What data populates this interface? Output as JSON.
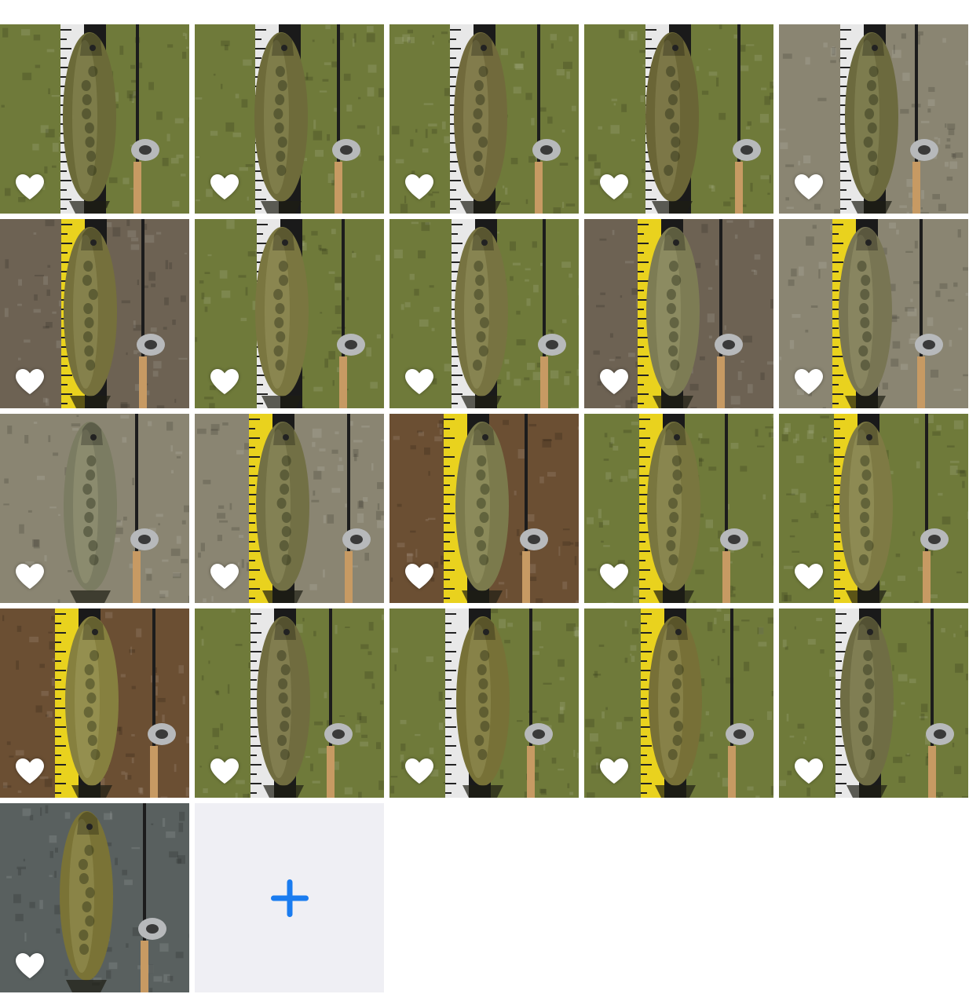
{
  "photos": [
    {
      "id": 1,
      "bg": "grass",
      "ruler": "white",
      "fish": "#6b6a38",
      "liked": false
    },
    {
      "id": 2,
      "bg": "grass",
      "ruler": "white",
      "fish": "#6e6b3a",
      "liked": false
    },
    {
      "id": 3,
      "bg": "grass",
      "ruler": "white",
      "fish": "#716a3c",
      "liked": false
    },
    {
      "id": 4,
      "bg": "grass",
      "ruler": "white",
      "fish": "#6a6536",
      "liked": false
    },
    {
      "id": 5,
      "bg": "dry",
      "ruler": "white",
      "fish": "#6c6a3e",
      "liked": false
    },
    {
      "id": 6,
      "bg": "dirt",
      "ruler": "yellow",
      "fish": "#75703c",
      "liked": false
    },
    {
      "id": 7,
      "bg": "grass",
      "ruler": "white",
      "fish": "#7a7640",
      "liked": false
    },
    {
      "id": 8,
      "bg": "grass",
      "ruler": "white",
      "fish": "#777341",
      "liked": false
    },
    {
      "id": 9,
      "bg": "dirt",
      "ruler": "yellow",
      "fish": "#7d7c54",
      "liked": false
    },
    {
      "id": 10,
      "bg": "dry",
      "ruler": "yellow",
      "fish": "#787553",
      "liked": false
    },
    {
      "id": 11,
      "bg": "dry",
      "ruler": "none",
      "fish": "#7b7c62",
      "liked": false
    },
    {
      "id": 12,
      "bg": "dry",
      "ruler": "yellow",
      "fish": "#727045",
      "liked": false
    },
    {
      "id": 13,
      "bg": "leaves",
      "ruler": "yellow",
      "fish": "#7b7a4c",
      "liked": false
    },
    {
      "id": 14,
      "bg": "grass",
      "ruler": "yellow",
      "fish": "#79763f",
      "liked": false
    },
    {
      "id": 15,
      "bg": "grass",
      "ruler": "yellow",
      "fish": "#7e7a44",
      "liked": false
    },
    {
      "id": 16,
      "bg": "leaves",
      "ruler": "yellow",
      "fish": "#86803f",
      "liked": false
    },
    {
      "id": 17,
      "bg": "grass",
      "ruler": "white",
      "fish": "#706c3f",
      "liked": false
    },
    {
      "id": 18,
      "bg": "grass",
      "ruler": "white",
      "fish": "#777137",
      "liked": false
    },
    {
      "id": 19,
      "bg": "grass",
      "ruler": "yellow",
      "fish": "#777037",
      "liked": false
    },
    {
      "id": 20,
      "bg": "grass",
      "ruler": "white",
      "fish": "#6f6d44",
      "liked": false
    },
    {
      "id": 21,
      "bg": "boat",
      "ruler": "none",
      "fish": "#7a7336",
      "liked": false
    }
  ],
  "colors": {
    "grass": "#6f7a3a",
    "dry": "#8a8572",
    "dirt": "#6d6253",
    "leaves": "#6b4f33",
    "boat": "#59605f",
    "add_tile_bg": "#efeff4",
    "add_icon": "#1a7cf0",
    "heart": "#ffffff"
  },
  "add_button": {
    "icon": "plus-icon"
  }
}
